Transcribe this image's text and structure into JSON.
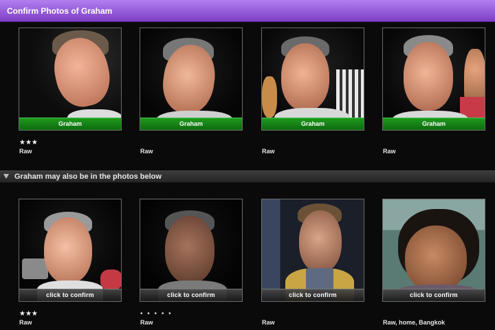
{
  "window": {
    "title": "Confirm Photos of Graham"
  },
  "confirmed": {
    "items": [
      {
        "label": "Graham",
        "rating": "★★★",
        "meta": "Raw"
      },
      {
        "label": "Graham",
        "rating": "",
        "meta": "Raw"
      },
      {
        "label": "Graham",
        "rating": "",
        "meta": "Raw"
      },
      {
        "label": "Graham",
        "rating": "",
        "meta": "Raw"
      }
    ]
  },
  "suggested": {
    "header": "Graham may also be in the photos below",
    "items": [
      {
        "label": "click to confirm",
        "rating": "★★★",
        "meta": "Raw"
      },
      {
        "label": "click to confirm",
        "rating": "• • • • •",
        "meta": "Raw"
      },
      {
        "label": "click to confirm",
        "rating": "",
        "meta": "Raw"
      },
      {
        "label": "click to confirm",
        "rating": "",
        "meta": "Raw, home, Bangkok"
      }
    ]
  },
  "icons": {
    "disclosure": "disclosure-triangle-icon"
  },
  "colors": {
    "title_bar": "#9b5de0",
    "name_bar": "#178a17",
    "background": "#0a0a0a"
  }
}
